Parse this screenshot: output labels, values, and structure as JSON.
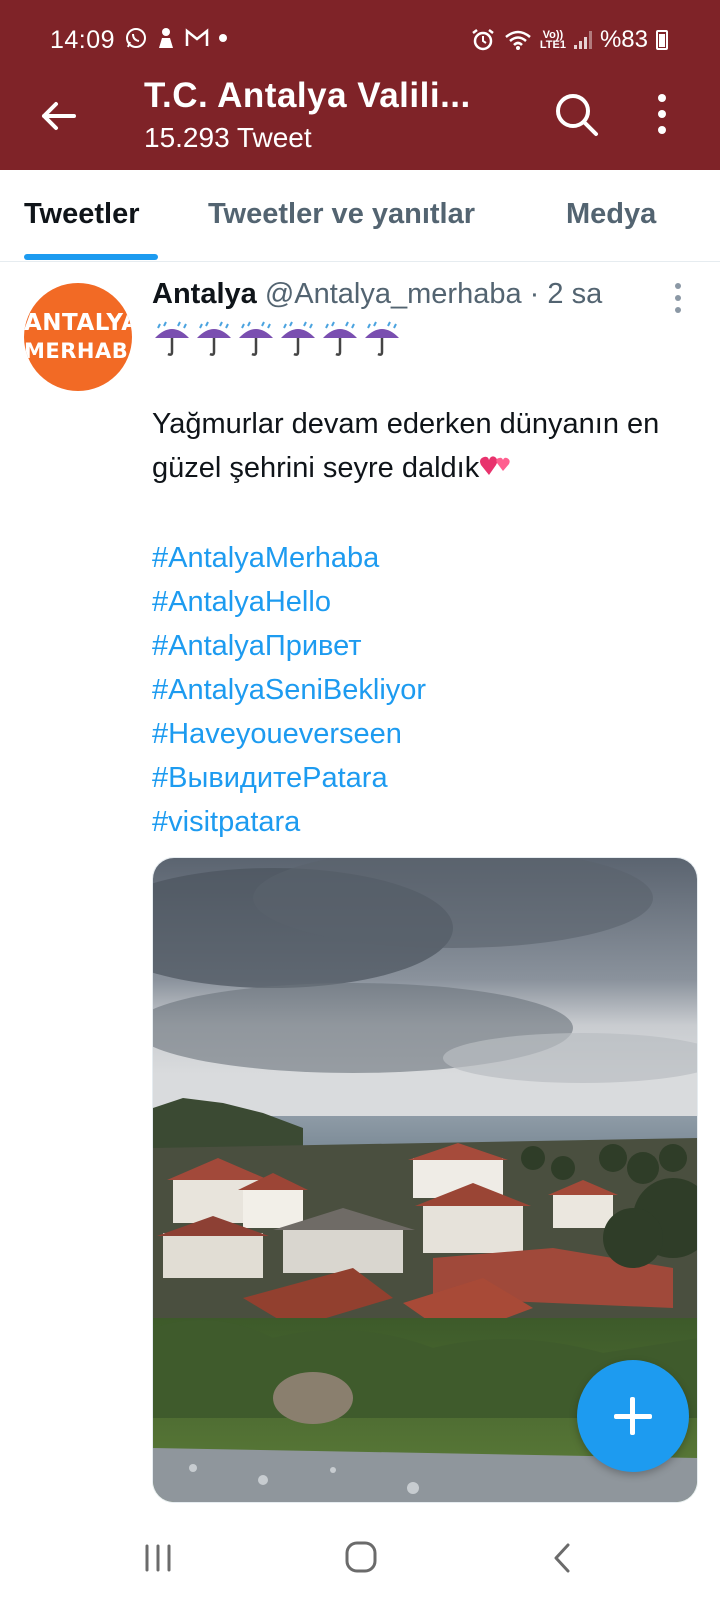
{
  "status_bar": {
    "time": "14:09",
    "left_icons": [
      "whatsapp-icon",
      "notification-icon",
      "gmail-icon",
      "dot"
    ],
    "right_icons": [
      "alarm-icon",
      "wifi-icon",
      "volte-icon",
      "signal-icon",
      "battery-icon"
    ],
    "volte_line1": "Vo))",
    "volte_line2": "LTE1",
    "battery_text": "%83"
  },
  "header": {
    "title": "T.C. Antalya Valili...",
    "subtitle": "15.293 Tweet",
    "bg_color": "#7f2328"
  },
  "tabs": [
    {
      "label": "Tweetler",
      "active": true
    },
    {
      "label": "Tweetler ve yanıtlar",
      "active": false
    },
    {
      "label": "Medya",
      "active": false
    }
  ],
  "tweet": {
    "avatar_line1": "ANTALYA",
    "avatar_line2": "MERHABA",
    "author_name": "Antalya",
    "handle": "@Antalya_merhaba",
    "separator": "·",
    "time_ago": "2 sa",
    "emoji_line": "☔☔☔☔☔☔",
    "text": "Yağmurlar devam ederken dünyanın en güzel şehrini seyre daldık",
    "hashtags": [
      "#AntalyaMerhaba",
      "#AntalyaHello",
      "#AntalyaПривет",
      "#AntalyaSeniBekliyor",
      "#Haveyoueverseen",
      "#ВывидитеPatara",
      "#visitpatara"
    ],
    "link_color": "#1d9bf0"
  },
  "fab": {
    "icon": "plus-icon",
    "color": "#1d9bf0"
  },
  "navbar": {
    "icons": [
      "recent-apps-icon",
      "home-icon",
      "back-icon"
    ]
  }
}
